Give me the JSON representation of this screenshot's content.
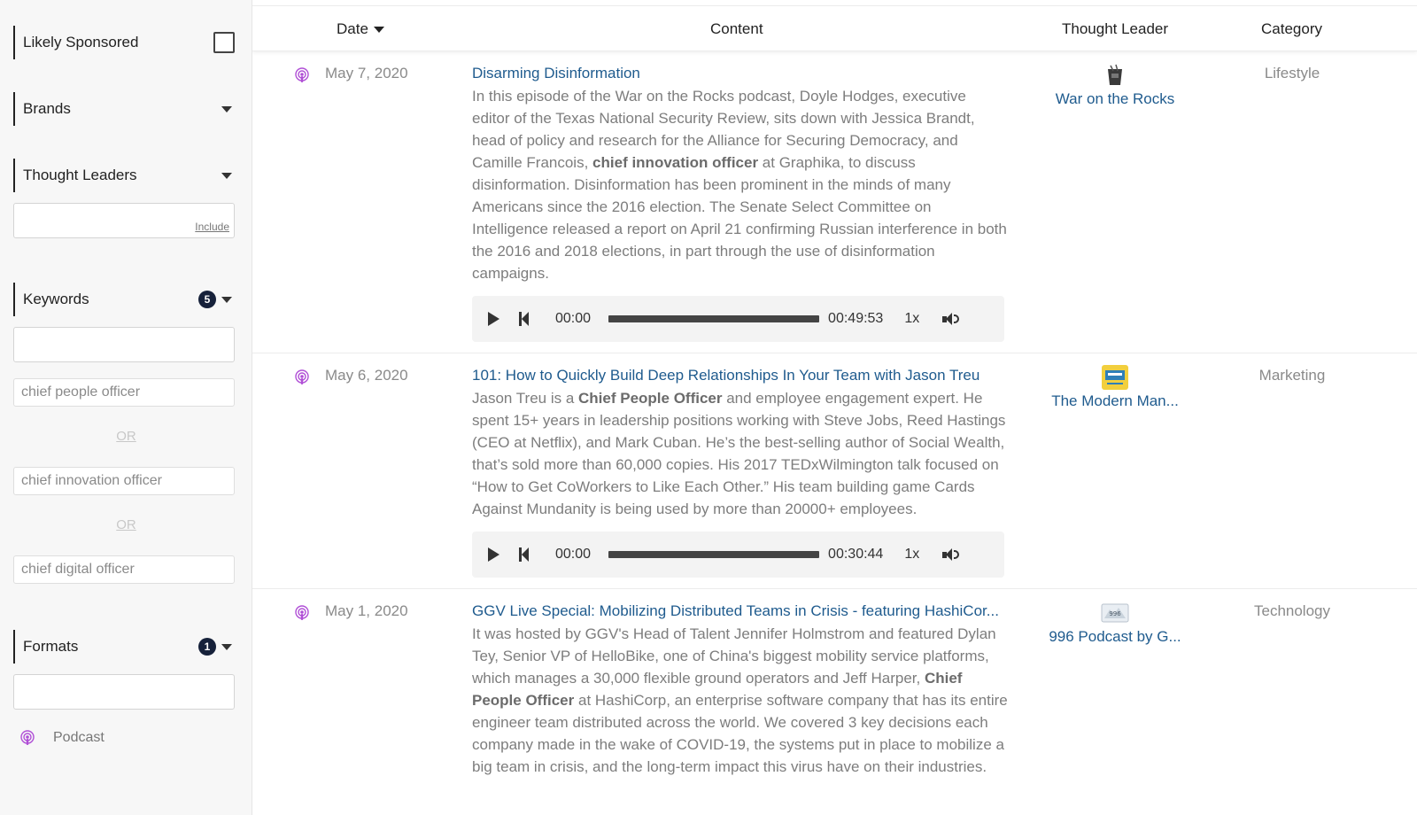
{
  "sidebar": {
    "likely_sponsored": {
      "label": "Likely Sponsored"
    },
    "brands": {
      "label": "Brands"
    },
    "thought_leaders": {
      "label": "Thought Leaders",
      "include_tag": "Include"
    },
    "keywords": {
      "label": "Keywords",
      "count": "5",
      "items": [
        "chief people officer",
        "chief innovation officer",
        "chief digital officer"
      ],
      "separator": "OR"
    },
    "formats": {
      "label": "Formats",
      "count": "1",
      "items": [
        {
          "label": "Podcast",
          "icon": "podcast-icon"
        }
      ]
    }
  },
  "table": {
    "headers": {
      "date": "Date",
      "content": "Content",
      "leader": "Thought Leader",
      "category": "Category"
    },
    "rows": [
      {
        "date": "May 7, 2020",
        "title": "Disarming Disinformation",
        "desc_parts": [
          "In this episode of the War on the Rocks podcast, Doyle Hodges, executive editor of the Texas National Security Review, sits down with Jessica Brandt, head of policy and research for the Alliance for Securing Democracy, and Camille Francois, ",
          "chief innovation officer",
          " at Graphika, to discuss disinformation.   Disinformation has been prominent in the minds of many Americans since the 2016 election. The Senate Select Committee on Intelligence released a report on April 21 confirming Russian interference in both the 2016 and 2018 elections, in part through the use of disinformation campaigns."
        ],
        "player": {
          "current": "00:00",
          "duration": "00:49:53",
          "speed": "1x"
        },
        "leader": "War on the Rocks",
        "category": "Lifestyle"
      },
      {
        "date": "May 6, 2020",
        "title": "101: How to Quickly Build Deep Relationships In Your Team with Jason Treu",
        "desc_parts": [
          "Jason Treu is a ",
          "Chief People Officer",
          " and employee engagement expert. He spent 15+ years in leadership positions working with Steve Jobs, Reed Hastings (CEO at Netflix), and Mark Cuban. He’s the best-selling author of Social Wealth, that’s sold more than 60,000 copies. His 2017 TEDxWilmington talk focused on “How to Get CoWorkers to Like Each Other.” His team building game Cards Against Mundanity is being used by more than 20000+ employees."
        ],
        "player": {
          "current": "00:00",
          "duration": "00:30:44",
          "speed": "1x"
        },
        "leader": "The Modern Man...",
        "category": "Marketing"
      },
      {
        "date": "May 1, 2020",
        "title": "GGV Live Special: Mobilizing Distributed Teams in Crisis - featuring HashiCor...",
        "desc_parts": [
          "It was hosted by GGV's Head of Talent Jennifer Holmstrom and featured Dylan Tey, Senior VP of HelloBike, one of China's biggest mobility service platforms, which manages a 30,000 flexible ground operators and Jeff Harper, ",
          "Chief People Officer",
          " at HashiCorp, an enterprise software company that has its entire engineer team distributed across the world.  We covered 3 key decisions each company made in the wake of COVID-19, the systems put in place to mobilize a big team in crisis, and the long-term impact this virus have on their industries."
        ],
        "leader": "996 Podcast by G...",
        "leader_logo_text": "996",
        "category": "Technology"
      }
    ]
  },
  "colors": {
    "accent_link": "#1f5b8e",
    "podcast_icon": "#b04fd6",
    "badge": "#16213a"
  }
}
